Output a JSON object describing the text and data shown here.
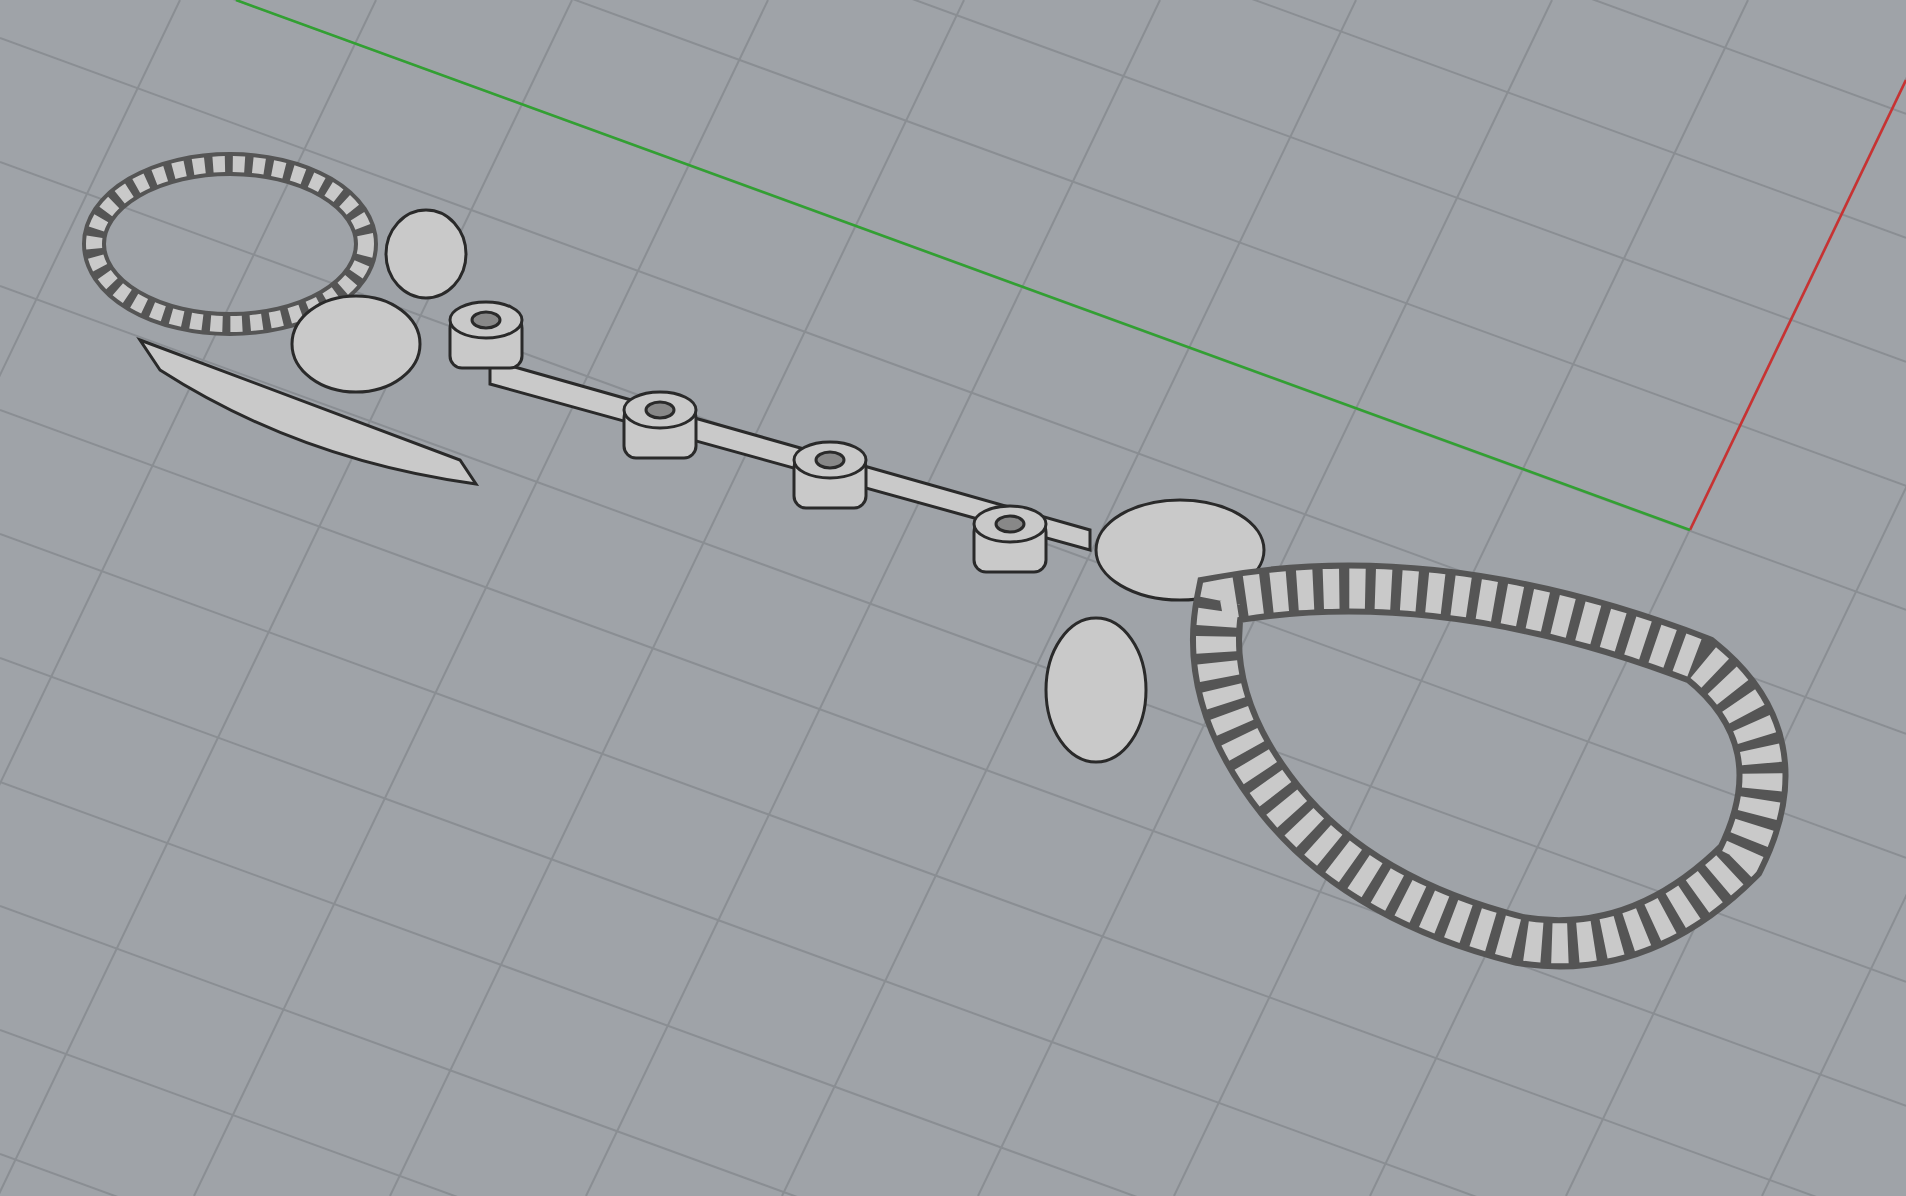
{
  "viewport": {
    "axes": [
      {
        "kind": "x",
        "color": "#c83232"
      },
      {
        "kind": "y",
        "color": "#32a032"
      }
    ]
  }
}
